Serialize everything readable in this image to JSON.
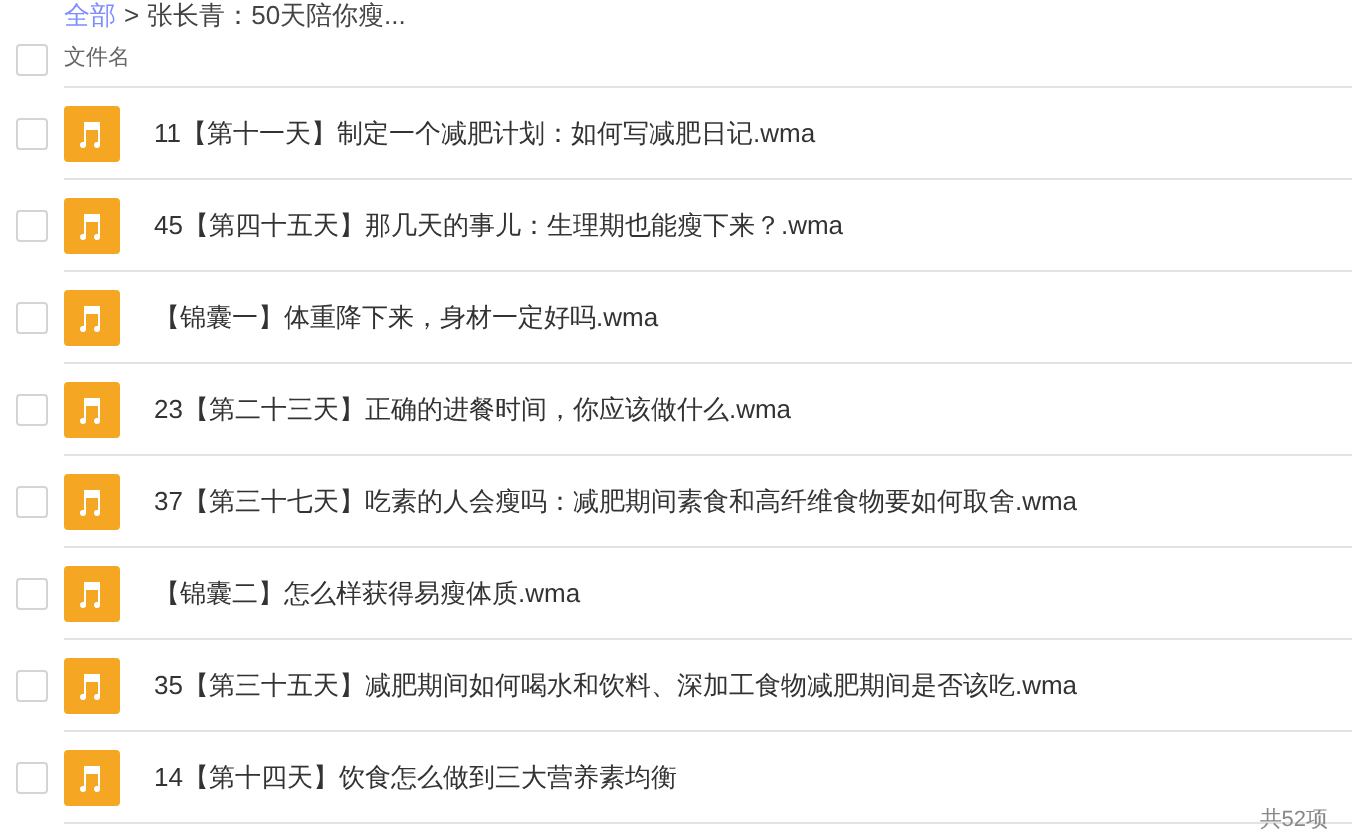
{
  "breadcrumb": {
    "root": "全部",
    "separator": ">",
    "current": "张长青：50天陪你瘦..."
  },
  "table": {
    "columns": [
      "文件名"
    ],
    "header_checked": false,
    "rows": [
      {
        "name": "11【第十一天】制定一个减肥计划：如何写减肥日记.wma",
        "checked": false
      },
      {
        "name": "45【第四十五天】那几天的事儿：生理期也能瘦下来？.wma",
        "checked": false
      },
      {
        "name": "【锦囊一】体重降下来，身材一定好吗.wma",
        "checked": false
      },
      {
        "name": "23【第二十三天】正确的进餐时间，你应该做什么.wma",
        "checked": false
      },
      {
        "name": "37【第三十七天】吃素的人会瘦吗：减肥期间素食和高纤维食物要如何取舍.wma",
        "checked": false
      },
      {
        "name": "【锦囊二】怎么样获得易瘦体质.wma",
        "checked": false
      },
      {
        "name": "35【第三十五天】减肥期间如何喝水和饮料、深加工食物减肥期间是否该吃.wma",
        "checked": false
      },
      {
        "name": "14【第十四天】饮食怎么做到三大营养素均衡",
        "checked": false
      }
    ]
  },
  "footer": {
    "count": "共52项"
  }
}
